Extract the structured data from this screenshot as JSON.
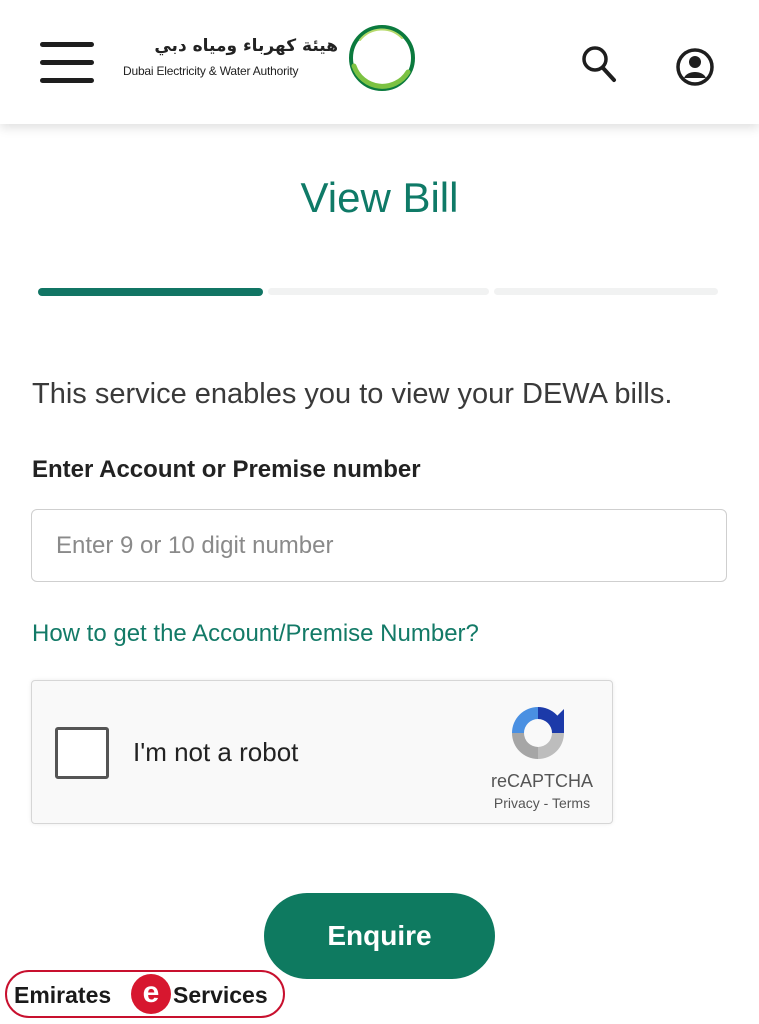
{
  "header": {
    "menu_icon": "hamburger-menu-icon",
    "logo_arabic": "هيئة كهرباء ومياه دبي",
    "logo_english": "Dubai Electricity & Water Authority",
    "search_icon": "search-icon",
    "account_icon": "user-account-icon"
  },
  "main": {
    "title": "View Bill",
    "steps": {
      "total": 3,
      "current": 1
    },
    "description": "This service enables you to view your DEWA bills.",
    "field_label": "Enter Account or Premise number",
    "field_placeholder": "Enter 9 or 10 digit number",
    "field_value": "",
    "help_link": "How to get the Account/Premise Number?",
    "submit_label": "Enquire"
  },
  "recaptcha": {
    "checkbox_label": "I'm not a robot",
    "checked": false,
    "brand": "reCAPTCHA",
    "privacy": "Privacy",
    "separator": " - ",
    "terms": "Terms"
  },
  "watermark": {
    "left": "Emirates",
    "letter": "e",
    "right": "Services"
  },
  "colors": {
    "brand_green": "#0f7a67",
    "button_green": "#0e7a60",
    "watermark_red": "#d7172f"
  }
}
